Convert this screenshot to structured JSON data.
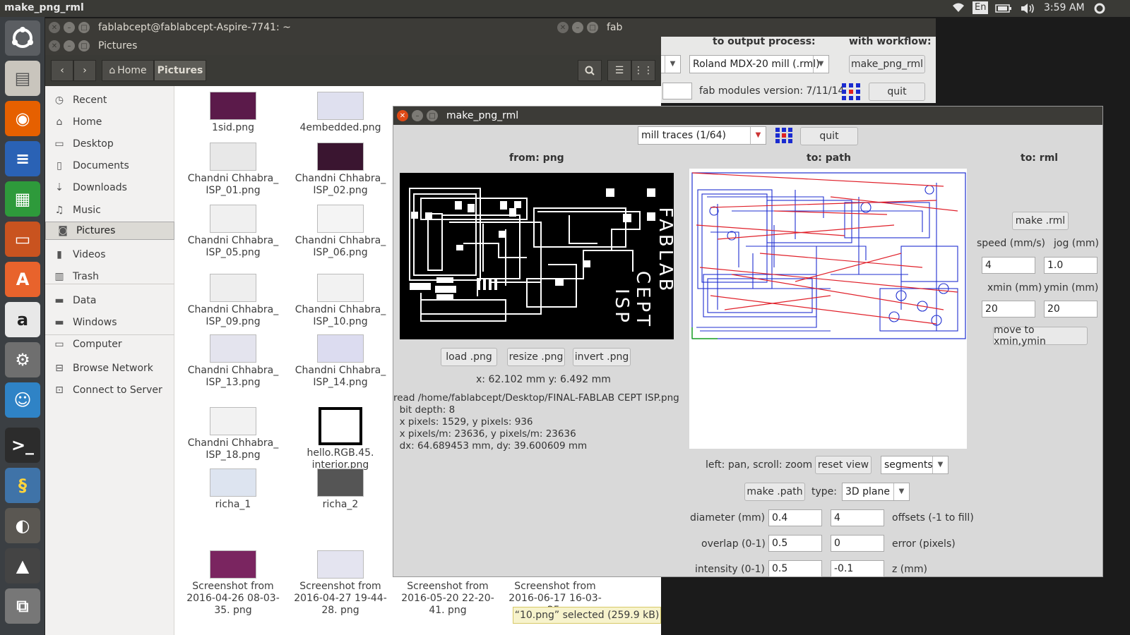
{
  "topbar": {
    "app_title": "make_png_rml",
    "lang": "En",
    "time": "3:59 AM"
  },
  "launcher": {
    "icons": [
      "ubuntu-dash-icon",
      "files-icon",
      "firefox-icon",
      "writer-icon",
      "calc-icon",
      "impress-icon",
      "software-center-icon",
      "amazon-icon",
      "settings-icon",
      "pidgin-icon",
      "terminal-icon",
      "python-icon",
      "gimp-icon",
      "inkscape-icon",
      "workspaces-icon"
    ]
  },
  "terminal": {
    "title": "fablabcept@fablabcept-Aspire-7741: ~"
  },
  "nautilus": {
    "title": "Pictures",
    "crumb_home": "Home",
    "crumb_current": "Pictures",
    "sidebar": [
      {
        "label": "Recent",
        "icon": "clock-icon"
      },
      {
        "label": "Home",
        "icon": "home-icon"
      },
      {
        "label": "Desktop",
        "icon": "desktop-icon"
      },
      {
        "label": "Documents",
        "icon": "document-icon"
      },
      {
        "label": "Downloads",
        "icon": "download-icon"
      },
      {
        "label": "Music",
        "icon": "music-icon"
      },
      {
        "label": "Pictures",
        "icon": "camera-icon"
      },
      {
        "label": "Videos",
        "icon": "video-icon"
      },
      {
        "label": "Trash",
        "icon": "trash-icon"
      },
      {
        "label": "Data",
        "icon": "drive-icon"
      },
      {
        "label": "Windows",
        "icon": "drive-icon"
      },
      {
        "label": "Computer",
        "icon": "computer-icon"
      },
      {
        "label": "Browse Network",
        "icon": "network-icon"
      },
      {
        "label": "Connect to Server",
        "icon": "server-icon"
      }
    ],
    "files": [
      [
        "1sid.png",
        "4embedded.png"
      ],
      [
        "Chandni Chhabra_ ISP_01.png",
        "Chandni Chhabra_ ISP_02.png"
      ],
      [
        "Chandni Chhabra_ ISP_05.png",
        "Chandni Chhabra_ ISP_06.png"
      ],
      [
        "Chandni Chhabra_ ISP_09.png",
        "Chandni Chhabra_ ISP_10.png"
      ],
      [
        "Chandni Chhabra_ ISP_13.png",
        "Chandni Chhabra_ ISP_14.png"
      ],
      [
        "Chandni Chhabra_ ISP_18.png",
        "hello.RGB.45. interior.png"
      ],
      [
        "richa_1",
        "richa_2"
      ],
      [
        "Screenshot from 2016-04-26 08-03-35. png",
        "Screenshot from 2016-04-27 19-44-28. png",
        "Screenshot from 2016-05-20 22-20-41. png",
        "Screenshot from 2016-06-17 16-03-25."
      ]
    ],
    "status": "“10.png” selected  (259.9 kB)"
  },
  "fab": {
    "title": "fab",
    "output_label": "to output process:",
    "workflow_label": "with workflow:",
    "output_value": "Roland MDX-20 mill (.rml)",
    "workflow_value": "make_png_rml",
    "version": "fab modules version: 7/11/14",
    "quit": "quit"
  },
  "png": {
    "title": "make_png_rml",
    "process": "mill traces (1/64)",
    "quit": "quit",
    "from_header": "from: png",
    "path_header": "to: path",
    "rml_header": "to: rml",
    "load": "load .png",
    "resize": "resize .png",
    "invert": "invert .png",
    "coords": "x: 62.102 mm  y: 6.492 mm",
    "info": [
      "read /home/fablabcept/Desktop/FINAL-FABLAB CEPT ISP.png",
      "  bit depth: 8",
      "  x pixels: 1529, y pixels: 936",
      "  x pixels/m: 23636, y pixels/m: 23636",
      "  dx: 64.689453 mm, dy: 39.600609 mm"
    ],
    "pcb_text": [
      "FABLAB",
      "CEPT",
      "ISP"
    ],
    "pan_hint": "left: pan, scroll: zoom",
    "reset_view": "reset view",
    "segments": "segments",
    "make_path": "make .path",
    "type_label": "type:",
    "type_value": "3D plane",
    "diameter_label": "diameter (mm)",
    "diameter": "0.4",
    "offsets": "4",
    "offsets_label": "offsets (-1 to fill)",
    "overlap_label": "overlap (0-1)",
    "overlap": "0.5",
    "error": "0",
    "error_label": "error (pixels)",
    "intensity_label": "intensity (0-1)",
    "intensity": "0.5",
    "z": "-0.1",
    "z_label": "z (mm)",
    "make_rml": "make .rml",
    "speed_label": "speed (mm/s)",
    "jog_label": "jog (mm)",
    "speed": "4",
    "jog": "1.0",
    "xmin_label": "xmin (mm)",
    "ymin_label": "ymin (mm)",
    "xmin": "20",
    "ymin": "20",
    "move": "move to xmin,ymin"
  },
  "colors": {
    "close": "#df4a16",
    "titlebar": "#3c3b37",
    "path_blue": "#1f2fd0",
    "path_red": "#e0202a"
  }
}
